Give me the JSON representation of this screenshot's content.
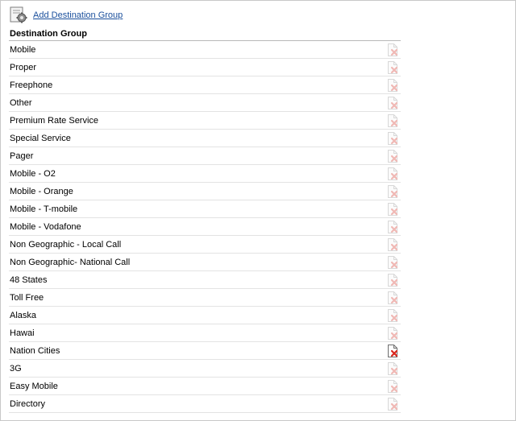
{
  "toolbar": {
    "add_link": "Add Destination Group",
    "icon": "gear-document-icon"
  },
  "table": {
    "header": "Destination Group",
    "rows": [
      {
        "label": "Mobile",
        "delete_enabled": false
      },
      {
        "label": "Proper",
        "delete_enabled": false
      },
      {
        "label": "Freephone",
        "delete_enabled": false
      },
      {
        "label": "Other",
        "delete_enabled": false
      },
      {
        "label": "Premium Rate Service",
        "delete_enabled": false
      },
      {
        "label": "Special Service",
        "delete_enabled": false
      },
      {
        "label": "Pager",
        "delete_enabled": false
      },
      {
        "label": "Mobile - O2",
        "delete_enabled": false
      },
      {
        "label": "Mobile - Orange",
        "delete_enabled": false
      },
      {
        "label": "Mobile - T-mobile",
        "delete_enabled": false
      },
      {
        "label": "Mobile - Vodafone",
        "delete_enabled": false
      },
      {
        "label": "Non Geographic - Local Call",
        "delete_enabled": false
      },
      {
        "label": "Non Geographic- National Call",
        "delete_enabled": false
      },
      {
        "label": "48 States",
        "delete_enabled": false
      },
      {
        "label": "Toll Free",
        "delete_enabled": false
      },
      {
        "label": "Alaska",
        "delete_enabled": false
      },
      {
        "label": "Hawai",
        "delete_enabled": false
      },
      {
        "label": "Nation Cities",
        "delete_enabled": true
      },
      {
        "label": "3G",
        "delete_enabled": false
      },
      {
        "label": "Easy Mobile",
        "delete_enabled": false
      },
      {
        "label": "Directory",
        "delete_enabled": false
      }
    ]
  },
  "colors": {
    "link": "#1a4f9c",
    "delete_active": "#d9261c",
    "delete_disabled": "#f0b8b4"
  }
}
